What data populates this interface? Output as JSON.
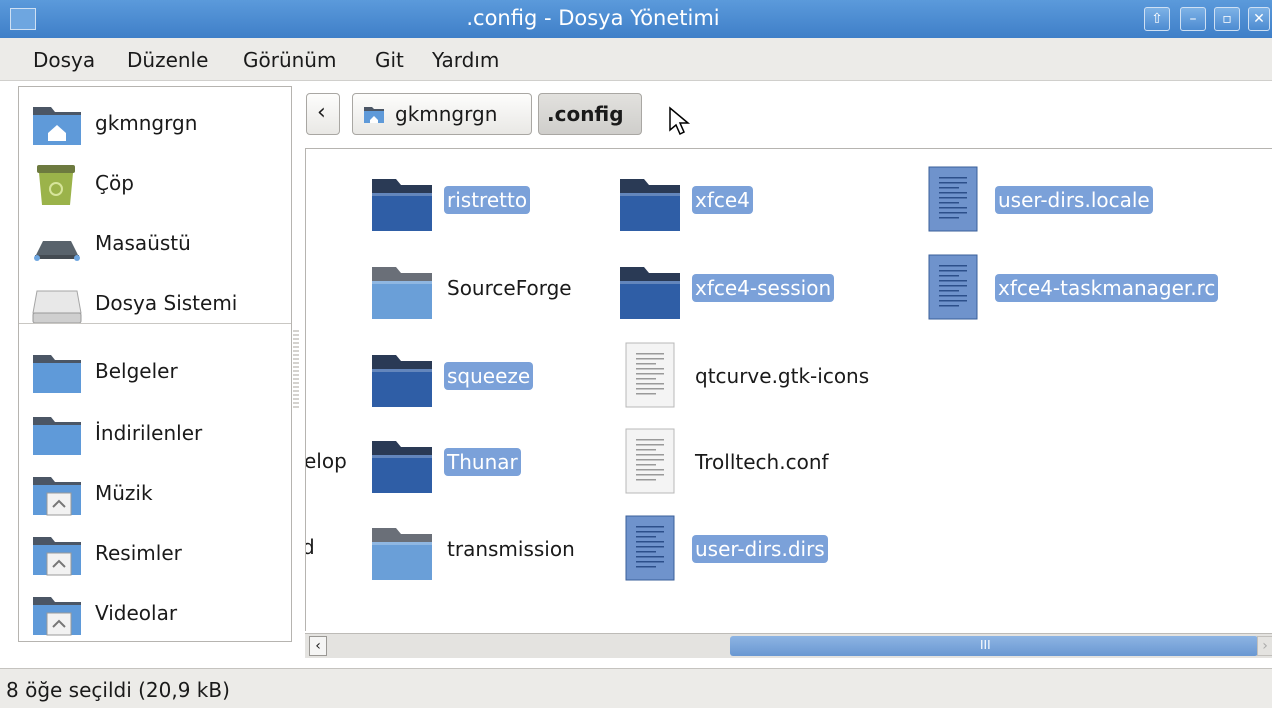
{
  "window": {
    "title": ".config - Dosya Yönetimi"
  },
  "menu": [
    {
      "label": "Dosya"
    },
    {
      "label": "Düzenle"
    },
    {
      "label": "Görünüm"
    },
    {
      "label": "Git"
    },
    {
      "label": "Yardım"
    }
  ],
  "sidebar": {
    "items": [
      {
        "label": "gkmngrgn",
        "icon": "home-folder-icon"
      },
      {
        "label": "Çöp",
        "icon": "trash-icon"
      },
      {
        "label": "Masaüstü",
        "icon": "desktop-icon"
      },
      {
        "label": "Dosya Sistemi",
        "icon": "drive-icon"
      },
      {
        "label": "Belgeler",
        "icon": "folder-icon"
      },
      {
        "label": "İndirilenler",
        "icon": "folder-icon"
      },
      {
        "label": "Müzik",
        "icon": "music-folder-icon"
      },
      {
        "label": "Resimler",
        "icon": "pictures-folder-icon"
      },
      {
        "label": "Videolar",
        "icon": "videos-folder-icon"
      }
    ]
  },
  "pathbar": {
    "back": "‹",
    "crumbs": [
      {
        "label": "gkmngrgn"
      },
      {
        "label": ".config"
      }
    ]
  },
  "files": [
    {
      "name": "ristretto",
      "kind": "folder",
      "selected": true
    },
    {
      "name": "xfce4",
      "kind": "folder",
      "selected": true
    },
    {
      "name": "user-dirs.locale",
      "kind": "text-file",
      "selected": true
    },
    {
      "name": "SourceForge",
      "kind": "folder",
      "selected": false
    },
    {
      "name": "xfce4-session",
      "kind": "folder",
      "selected": true
    },
    {
      "name": "xfce4-taskmanager.rc",
      "kind": "text-file",
      "selected": true
    },
    {
      "name": "squeeze",
      "kind": "folder",
      "selected": true
    },
    {
      "name": "qtcurve.gtk-icons",
      "kind": "text-file",
      "selected": false
    },
    {
      "name": "Thunar",
      "kind": "folder",
      "selected": true
    },
    {
      "name": "Trolltech.conf",
      "kind": "text-file",
      "selected": false
    },
    {
      "name": "transmission",
      "kind": "folder",
      "selected": false
    },
    {
      "name": "user-dirs.dirs",
      "kind": "text-file",
      "selected": true
    }
  ],
  "clipped_names": {
    "row4": "elop",
    "row5": "d"
  },
  "scrollbar": {
    "grip": "III",
    "left_arrow": "‹",
    "right_arrow": "›"
  },
  "status": {
    "text": "8 öğe seçildi (20,9 kB)"
  },
  "colors": {
    "titlebar": "#4a8ad1",
    "selection": "#7ba1d9",
    "folder_dark": "#2f5ea6",
    "folder_light": "#6a9fd8"
  }
}
